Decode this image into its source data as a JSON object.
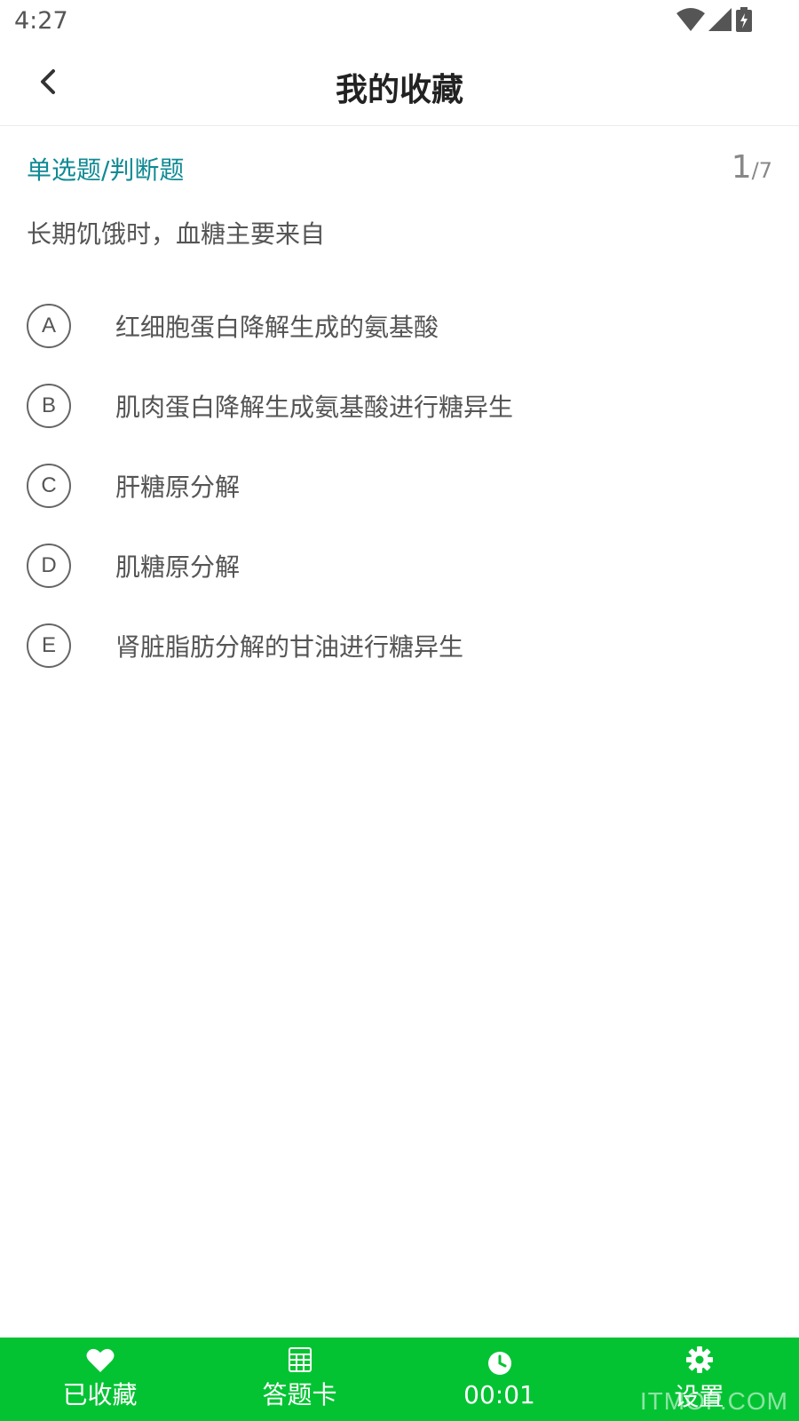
{
  "status_bar": {
    "time": "4:27",
    "icons": [
      "wifi-icon",
      "cell-signal-icon",
      "battery-charging-icon"
    ]
  },
  "app_bar": {
    "title": "我的收藏",
    "back_icon": "chevron-left-icon"
  },
  "question": {
    "type": "单选题/判断题",
    "current": "1",
    "total": "/7",
    "text": "长期饥饿时，血糖主要来自",
    "options": [
      {
        "letter": "A",
        "text": "红细胞蛋白降解生成的氨基酸"
      },
      {
        "letter": "B",
        "text": "肌肉蛋白降解生成氨基酸进行糖异生"
      },
      {
        "letter": "C",
        "text": "肝糖原分解"
      },
      {
        "letter": "D",
        "text": "肌糖原分解"
      },
      {
        "letter": "E",
        "text": "肾脏脂肪分解的甘油进行糖异生"
      }
    ]
  },
  "bottom_nav": {
    "accent_color": "#04c333",
    "items": [
      {
        "label": "已收藏",
        "icon": "heart-icon"
      },
      {
        "label": "答题卡",
        "icon": "grid-card-icon"
      },
      {
        "label": "00:01",
        "icon": "clock-icon"
      },
      {
        "label": "设置",
        "icon": "gear-icon"
      }
    ],
    "watermark": "ITMOP.COM"
  }
}
